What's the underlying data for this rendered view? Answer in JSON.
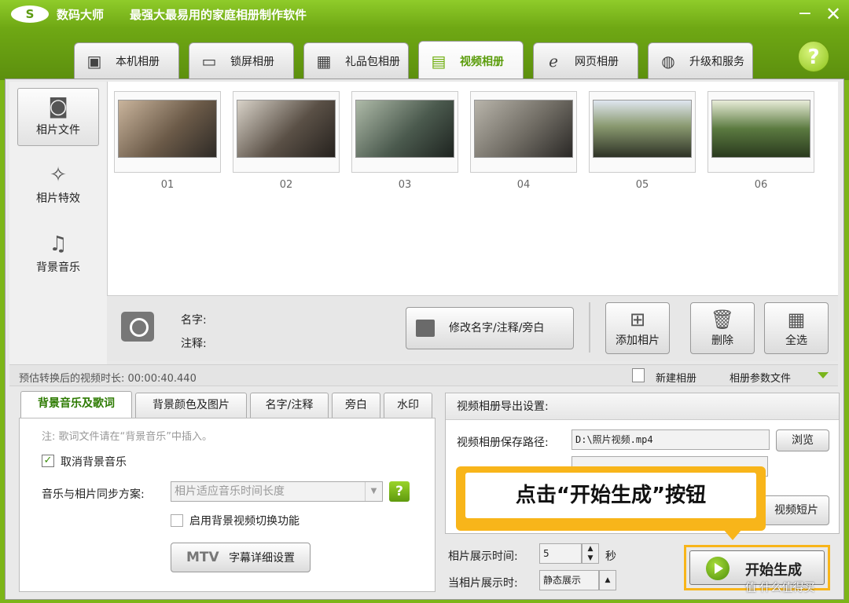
{
  "titlebar": {
    "app_name": "数码大师",
    "slogan": "最强大最易用的家庭相册制作软件",
    "minimize": "−",
    "close": "✕"
  },
  "tabs": [
    {
      "label": "本机相册",
      "icon": "portrait-icon"
    },
    {
      "label": "锁屏相册",
      "icon": "monitor-icon"
    },
    {
      "label": "礼品包相册",
      "icon": "gift-icon"
    },
    {
      "label": "视频相册",
      "icon": "film-icon",
      "active": true
    },
    {
      "label": "网页相册",
      "icon": "ie-icon"
    },
    {
      "label": "升级和服务",
      "icon": "globe-icon"
    }
  ],
  "help": "?",
  "leftnav": {
    "items": [
      {
        "label": "相片文件"
      },
      {
        "label": "相片特效"
      },
      {
        "label": "背景音乐"
      }
    ]
  },
  "photos": [
    {
      "label": "01",
      "color": "#6b5a48"
    },
    {
      "label": "02",
      "color": "#5a5046"
    },
    {
      "label": "03",
      "color": "#4b5a4e"
    },
    {
      "label": "04",
      "color": "#6e6a62"
    },
    {
      "label": "05",
      "color": "#5d6a48"
    },
    {
      "label": "06",
      "color": "#5b7a40"
    }
  ],
  "infobar": {
    "name_label": "名字:",
    "note_label": "注释:",
    "edit_button": "修改名字/注释/旁白",
    "add_button": "添加相片",
    "delete_button": "删除",
    "select_all_button": "全选"
  },
  "statusbar": {
    "duration": "预估转换后的视频时长: 00:00:40.440",
    "new_album": "新建相册",
    "album_params": "相册参数文件"
  },
  "subtabs": [
    "背景音乐及歌词",
    "背景颜色及图片",
    "名字/注释",
    "旁白",
    "水印"
  ],
  "music": {
    "note": "注: 歌词文件请在“背景音乐”中插入。",
    "cancel_music": "取消背景音乐",
    "sync_label": "音乐与相片同步方案:",
    "sync_value": "相片适应音乐时间长度",
    "video_switch": "启用背景视频切换功能",
    "mtv_prefix": "MTV",
    "mtv_label": "字幕详细设置"
  },
  "export": {
    "header": "视频相册导出设置:",
    "path_label": "视频相册保存路径:",
    "path_value": "D:\\照片视频.mp4",
    "browse": "浏览",
    "short_video": "视频短片"
  },
  "timing": {
    "show_label": "相片展示时间:",
    "show_value": "5",
    "unit": "秒",
    "when_label": "当相片展示时:",
    "when_value": "静态展示"
  },
  "callout": "点击“开始生成”按钮",
  "start_button": "开始生成",
  "watermark": "值 什么值得买"
}
